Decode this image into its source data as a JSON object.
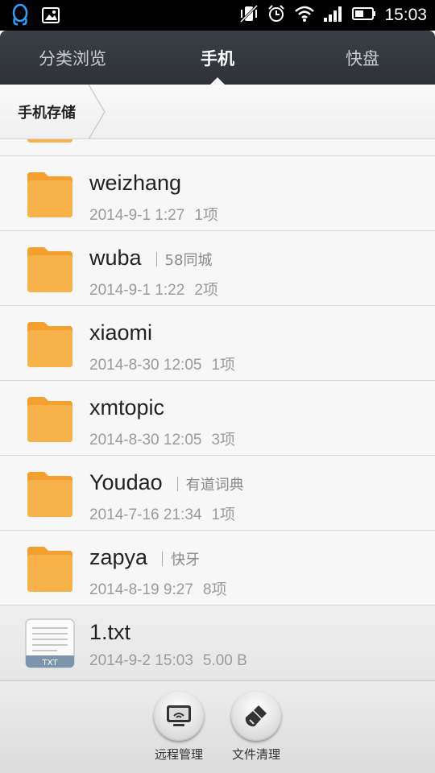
{
  "status_bar": {
    "time": "15:03",
    "left_icons": [
      "qq-penguin-icon",
      "image-icon"
    ],
    "right_icons": [
      "vibrate-off-icon",
      "alarm-icon",
      "wifi-icon",
      "signal-icon",
      "battery-icon"
    ]
  },
  "tabs": [
    {
      "label": "分类浏览",
      "active": false
    },
    {
      "label": "手机",
      "active": true
    },
    {
      "label": "快盘",
      "active": false
    }
  ],
  "breadcrumb": {
    "label": "手机存储"
  },
  "items": [
    {
      "name": "weizhang",
      "alias": "",
      "date": "2014-9-1 1:27",
      "count": "1项",
      "type": "folder"
    },
    {
      "name": "wuba",
      "alias": "58同城",
      "date": "2014-9-1 1:22",
      "count": "2项",
      "type": "folder"
    },
    {
      "name": "xiaomi",
      "alias": "",
      "date": "2014-8-30 12:05",
      "count": "1项",
      "type": "folder"
    },
    {
      "name": "xmtopic",
      "alias": "",
      "date": "2014-8-30 12:05",
      "count": "3项",
      "type": "folder"
    },
    {
      "name": "Youdao",
      "alias": "有道词典",
      "date": "2014-7-16 21:34",
      "count": "1项",
      "type": "folder"
    },
    {
      "name": "zapya",
      "alias": "快牙",
      "date": "2014-8-19 9:27",
      "count": "8项",
      "type": "folder"
    },
    {
      "name": "1.txt",
      "alias": "",
      "date": "2014-9-2 15:03",
      "count": "5.00 B",
      "type": "txt",
      "badge": "TXT"
    }
  ],
  "bottom_actions": [
    {
      "label": "远程管理",
      "icon": "remote-manage-icon"
    },
    {
      "label": "文件清理",
      "icon": "broom-clean-icon"
    }
  ],
  "colors": {
    "folder": "#f5a93a",
    "tab_bg": "#33373d",
    "accent_text": "#222222"
  }
}
